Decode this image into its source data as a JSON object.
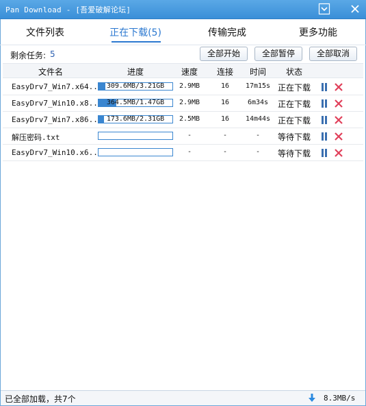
{
  "window": {
    "title": "Pan Download - [吾爱破解论坛]"
  },
  "tabs": [
    {
      "label": "文件列表"
    },
    {
      "label": "正在下载(5)"
    },
    {
      "label": "传输完成"
    },
    {
      "label": "更多功能"
    }
  ],
  "active_tab": 1,
  "toolbar": {
    "remaining_label": "剩余任务:",
    "remaining_count": "5",
    "start_all": "全部开始",
    "pause_all": "全部暂停",
    "cancel_all": "全部取消"
  },
  "columns": [
    "文件名",
    "进度",
    "速度",
    "连接",
    "时间",
    "状态"
  ],
  "rows": [
    {
      "name": "EasyDrv7_Win7.x64...",
      "progress_text": "309.6MB/3.21GB",
      "progress": 0.094,
      "speed": "2.9MB",
      "conn": "16",
      "time": "17m15s",
      "status": "正在下载"
    },
    {
      "name": "EasyDrv7_Win10.x8...",
      "progress_text": "364.5MB/1.47GB",
      "progress": 0.24,
      "speed": "2.9MB",
      "conn": "16",
      "time": "6m34s",
      "status": "正在下载"
    },
    {
      "name": "EasyDrv7_Win7.x86...",
      "progress_text": "173.6MB/2.31GB",
      "progress": 0.073,
      "speed": "2.5MB",
      "conn": "16",
      "time": "14m44s",
      "status": "正在下载"
    },
    {
      "name": "解压密码.txt",
      "progress_text": "",
      "progress": 0,
      "speed": "-",
      "conn": "-",
      "time": "-",
      "status": "等待下载"
    },
    {
      "name": "EasyDrv7_Win10.x6...",
      "progress_text": "",
      "progress": 0,
      "speed": "-",
      "conn": "-",
      "time": "-",
      "status": "等待下载"
    }
  ],
  "statusbar": {
    "left_text": "已全部加载，共7个",
    "total_speed": "8.3MB/s"
  },
  "colors": {
    "accent": "#2b78d0",
    "progress": "#3a86d0",
    "cancel": "#e0405a",
    "pause": "#3a6fb0"
  },
  "icons": {
    "pause": "pause-icon",
    "cancel": "close-x-icon",
    "download": "arrow-down-icon"
  }
}
